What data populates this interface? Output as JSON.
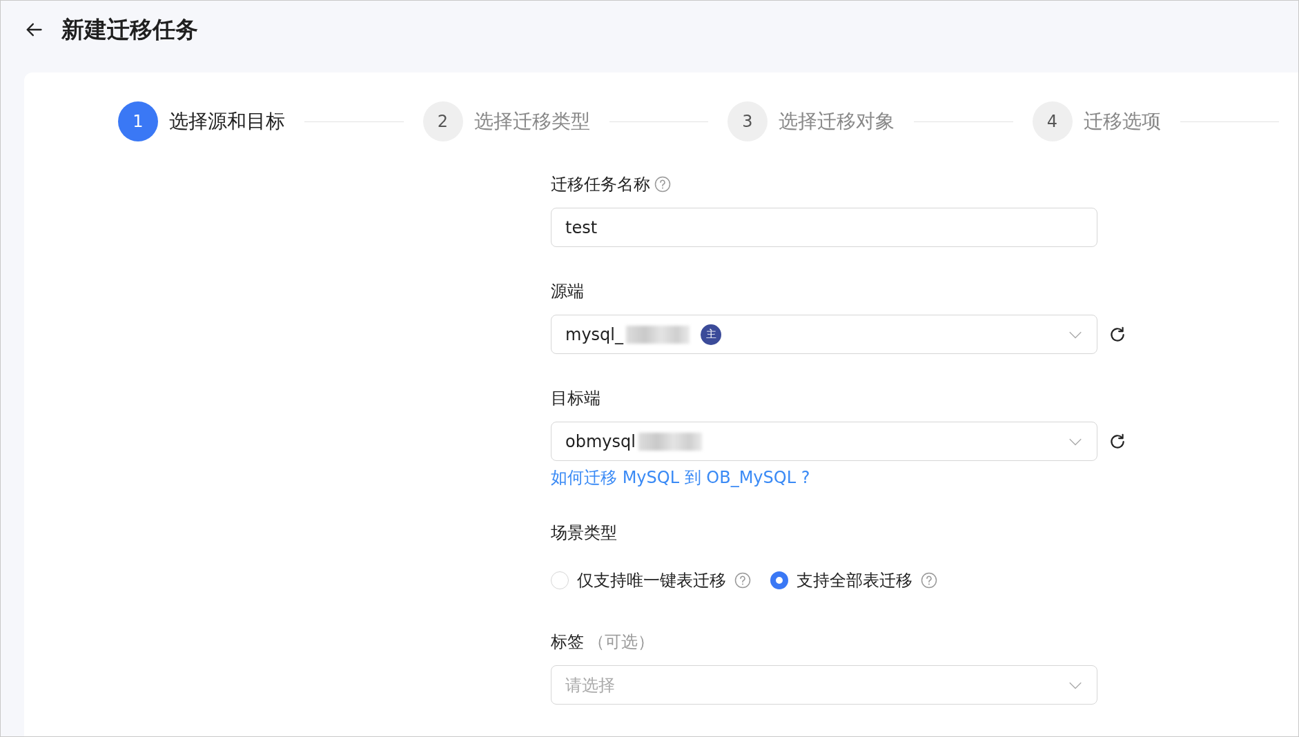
{
  "header": {
    "title": "新建迁移任务"
  },
  "steps": [
    {
      "number": "1",
      "label": "选择源和目标",
      "selected": true
    },
    {
      "number": "2",
      "label": "选择迁移类型",
      "selected": false
    },
    {
      "number": "3",
      "label": "选择迁移对象",
      "selected": false
    },
    {
      "number": "4",
      "label": "迁移选项",
      "selected": false
    }
  ],
  "form": {
    "fields": [
      {
        "kind": "text",
        "label": "迁移任务名称",
        "help": true,
        "value": "test"
      },
      {
        "kind": "select",
        "label": "源端",
        "value": "mysql_",
        "redacted": true,
        "badge": "主",
        "refresh": true
      },
      {
        "kind": "select",
        "label": "目标端",
        "value": "obmysql",
        "redacted": true,
        "refresh": true,
        "link": "如何迁移 MySQL 到 OB_MySQL ?"
      },
      {
        "kind": "radio",
        "label": "场景类型",
        "options": [
          {
            "label": "仅支持唯一键表迁移",
            "selected": false,
            "help": true
          },
          {
            "label": "支持全部表迁移",
            "selected": true,
            "help": true
          }
        ]
      },
      {
        "kind": "select",
        "label": "标签",
        "hint": "（可选）",
        "placeholder": "请选择"
      }
    ]
  }
}
